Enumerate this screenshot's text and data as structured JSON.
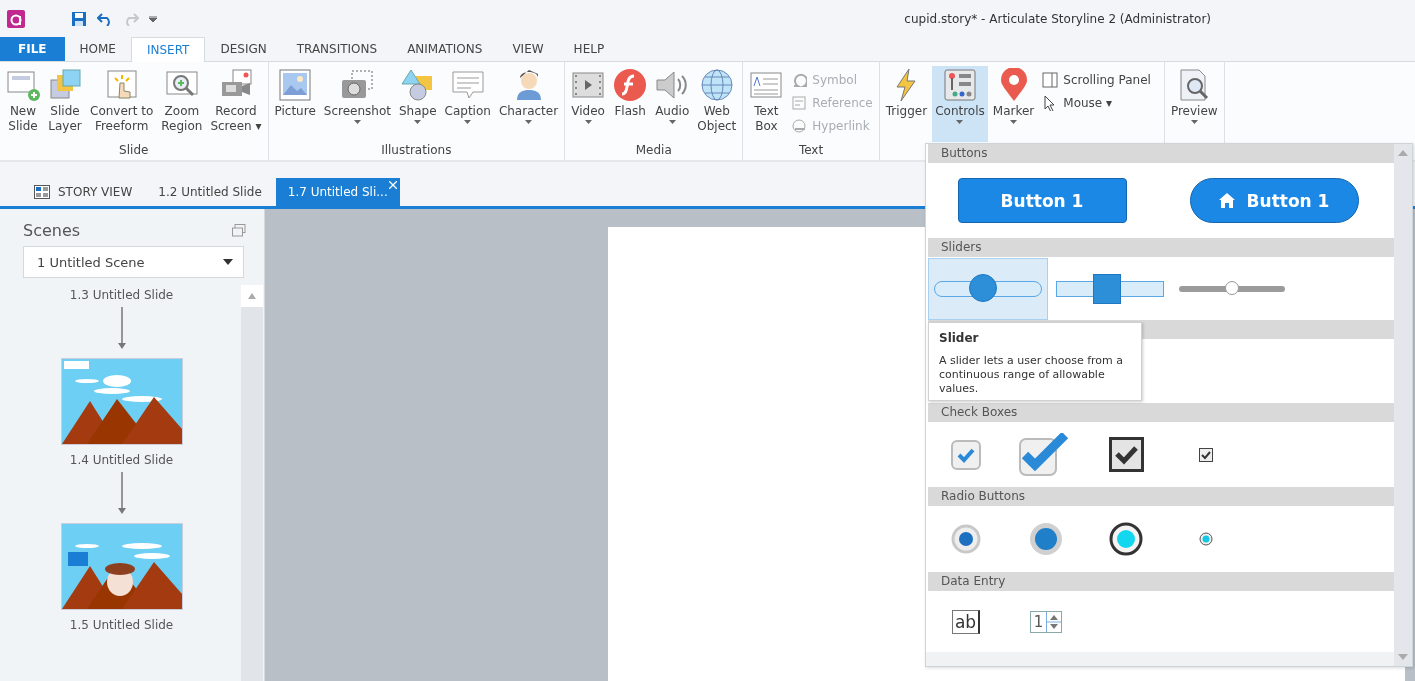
{
  "window": {
    "title": "cupid.story* -  Articulate Storyline 2 (Administrator)"
  },
  "menu_tabs": [
    {
      "label": "FILE",
      "kind": "file",
      "selected": false
    },
    {
      "label": "HOME",
      "kind": "tab",
      "selected": false
    },
    {
      "label": "INSERT",
      "kind": "tab",
      "selected": true
    },
    {
      "label": "DESIGN",
      "kind": "tab",
      "selected": false
    },
    {
      "label": "TRANSITIONS",
      "kind": "tab",
      "selected": false
    },
    {
      "label": "ANIMATIONS",
      "kind": "tab",
      "selected": false
    },
    {
      "label": "VIEW",
      "kind": "tab",
      "selected": false
    },
    {
      "label": "HELP",
      "kind": "tab",
      "selected": false
    }
  ],
  "ribbon": [
    {
      "label": "Slide",
      "items": [
        {
          "kind": "large",
          "label": "New\nSlide"
        },
        {
          "kind": "large",
          "label": "Slide\nLayer"
        },
        {
          "kind": "large",
          "label": "Convert to\nFreeform"
        },
        {
          "kind": "large",
          "label": "Zoom\nRegion"
        },
        {
          "kind": "large",
          "label": "Record\nScreen ▾"
        }
      ]
    },
    {
      "label": "Illustrations",
      "items": [
        {
          "kind": "large",
          "label": "Picture"
        },
        {
          "kind": "large",
          "label": "Screenshot",
          "dropdown": true
        },
        {
          "kind": "large",
          "label": "Shape",
          "dropdown": true
        },
        {
          "kind": "large",
          "label": "Caption",
          "dropdown": true
        },
        {
          "kind": "large",
          "label": "Character",
          "dropdown": true
        }
      ]
    },
    {
      "label": "Media",
      "items": [
        {
          "kind": "large",
          "label": "Video",
          "dropdown": true
        },
        {
          "kind": "large",
          "label": "Flash"
        },
        {
          "kind": "large",
          "label": "Audio",
          "dropdown": true
        },
        {
          "kind": "large",
          "label": "Web\nObject"
        }
      ]
    },
    {
      "label": "Text",
      "items": [
        {
          "kind": "large",
          "label": "Text\nBox"
        },
        {
          "kind": "small",
          "label": "Symbol",
          "disabled": true
        },
        {
          "kind": "small",
          "label": "Reference",
          "disabled": true
        },
        {
          "kind": "small",
          "label": "Hyperlink",
          "disabled": true
        }
      ]
    },
    {
      "items": [
        {
          "kind": "large",
          "label": "Trigger"
        },
        {
          "kind": "large",
          "label": "Controls",
          "dropdown": true,
          "selected": true
        },
        {
          "kind": "large",
          "label": "Marker",
          "dropdown": true
        },
        {
          "kind": "small",
          "label": "Scrolling Panel"
        },
        {
          "kind": "small",
          "label": "Mouse ▾"
        }
      ]
    },
    {
      "items": [
        {
          "kind": "large",
          "label": "Preview",
          "dropdown": true
        }
      ]
    }
  ],
  "doc_tabs": [
    {
      "label": "STORY VIEW",
      "kind": "story",
      "selected": false
    },
    {
      "label": "1.2 Untitled Slide",
      "kind": "slide",
      "selected": false
    },
    {
      "label": "1.7 Untitled Sli...",
      "kind": "slide",
      "selected": true
    }
  ],
  "scenes": {
    "title": "Scenes",
    "dropdown": "1 Untitled Scene",
    "slides": [
      {
        "label": "1.3 Untitled Slide",
        "thumbnail": false
      },
      {
        "label": "1.4 Untitled Slide",
        "thumbnail": true
      },
      {
        "label": "1.5 Untitled Slide",
        "thumbnail": true
      }
    ]
  },
  "controls_panel": {
    "sections": [
      {
        "kind": "buttons",
        "title": "Buttons",
        "items": [
          {
            "kind": "button",
            "label": "Button 1"
          },
          {
            "kind": "home-button",
            "label": "Button 1"
          }
        ]
      },
      {
        "kind": "sliders",
        "title": "Sliders",
        "items": [
          {
            "kind": "round-slider",
            "level": 0.45,
            "selected": true
          },
          {
            "kind": "square-slider",
            "level": 0.47,
            "selected": false
          },
          {
            "kind": "thin-slider",
            "level": 0.5,
            "selected": false
          }
        ]
      },
      {
        "kind": "hidden"
      },
      {
        "kind": "checkboxes",
        "title": "Check Boxes",
        "items": [
          {
            "kind": "soft-checkbox",
            "checked": true
          },
          {
            "kind": "large-checkbox",
            "checked": true
          },
          {
            "kind": "dark-checkbox",
            "checked": true
          },
          {
            "kind": "small-checkbox",
            "checked": true
          }
        ]
      },
      {
        "kind": "radios",
        "title": "Radio Buttons",
        "items": [
          {
            "kind": "soft-radio",
            "checked": true
          },
          {
            "kind": "large-radio",
            "checked": true
          },
          {
            "kind": "ring-radio",
            "checked": true
          },
          {
            "kind": "small-radio",
            "checked": true
          }
        ]
      },
      {
        "kind": "data-entry",
        "title": "Data Entry",
        "items": [
          {
            "kind": "text-entry",
            "value": "ab"
          },
          {
            "kind": "spinner",
            "value": "1"
          }
        ]
      }
    ],
    "tooltip": {
      "title": "Slider",
      "text": "A slider lets a user choose from a continuous range of allowable values."
    }
  }
}
